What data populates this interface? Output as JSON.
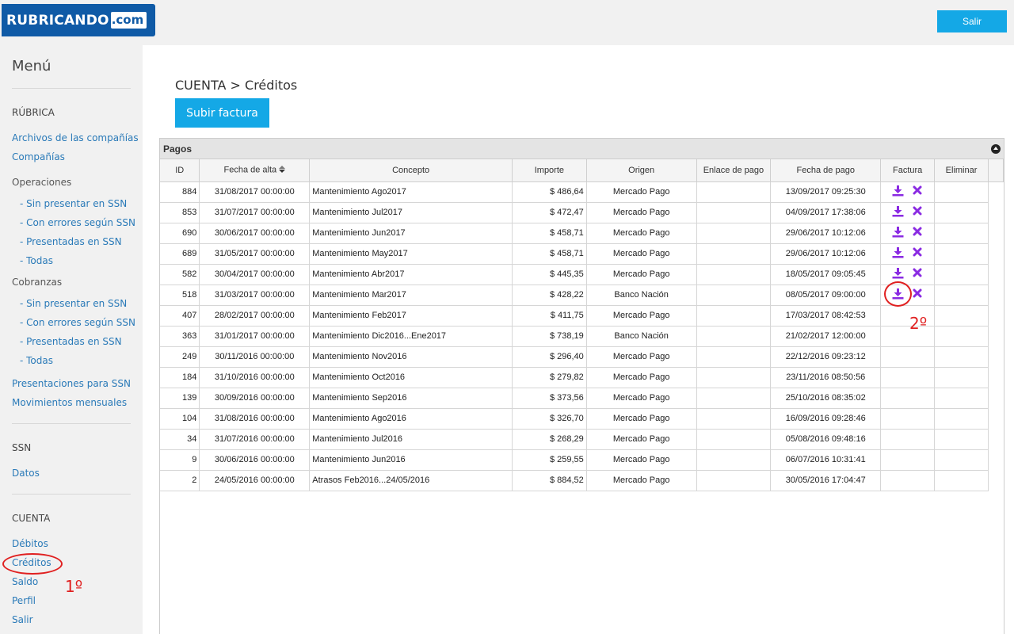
{
  "header": {
    "logo_part1": "RUBRICANDO",
    "logo_part2": ".com",
    "logout_label": "Salir"
  },
  "sidebar": {
    "title": "Menú",
    "rubrica": {
      "heading": "RÚBRICA",
      "archivos": "Archivos de las compañías",
      "companias": "Compañías",
      "operaciones": "Operaciones",
      "op_sin_presentar": "- Sin presentar en SSN",
      "op_con_errores": "- Con errores según SSN",
      "op_presentadas": "- Presentadas en SSN",
      "op_todas": "- Todas",
      "cobranzas": "Cobranzas",
      "co_sin_presentar": "- Sin presentar en SSN",
      "co_con_errores": "- Con errores según SSN",
      "co_presentadas": "- Presentadas en SSN",
      "co_todas": "- Todas",
      "presentaciones": "Presentaciones para SSN",
      "movimientos": "Movimientos mensuales"
    },
    "ssn": {
      "heading": "SSN",
      "datos": "Datos"
    },
    "cuenta": {
      "heading": "CUENTA",
      "debitos": "Débitos",
      "creditos": "Créditos",
      "saldo": "Saldo",
      "perfil": "Perfil",
      "salir": "Salir"
    }
  },
  "main": {
    "breadcrumb": "CUENTA > Créditos",
    "upload_label": "Subir factura",
    "panel_title": "Pagos",
    "columns": [
      "ID",
      "Fecha de alta",
      "Concepto",
      "Importe",
      "Origen",
      "Enlace de pago",
      "Fecha de pago",
      "Factura",
      "Eliminar"
    ],
    "rows": [
      {
        "id": "884",
        "fecha_alta": "31/08/2017 00:00:00",
        "concepto": "Mantenimiento Ago2017",
        "importe": "$ 486,64",
        "origen": "Mercado Pago",
        "enlace": "",
        "fecha_pago": "13/09/2017 09:25:30",
        "factura": true
      },
      {
        "id": "853",
        "fecha_alta": "31/07/2017 00:00:00",
        "concepto": "Mantenimiento Jul2017",
        "importe": "$ 472,47",
        "origen": "Mercado Pago",
        "enlace": "",
        "fecha_pago": "04/09/2017 17:38:06",
        "factura": true
      },
      {
        "id": "690",
        "fecha_alta": "30/06/2017 00:00:00",
        "concepto": "Mantenimiento Jun2017",
        "importe": "$ 458,71",
        "origen": "Mercado Pago",
        "enlace": "",
        "fecha_pago": "29/06/2017 10:12:06",
        "factura": true
      },
      {
        "id": "689",
        "fecha_alta": "31/05/2017 00:00:00",
        "concepto": "Mantenimiento May2017",
        "importe": "$ 458,71",
        "origen": "Mercado Pago",
        "enlace": "",
        "fecha_pago": "29/06/2017 10:12:06",
        "factura": true
      },
      {
        "id": "582",
        "fecha_alta": "30/04/2017 00:00:00",
        "concepto": "Mantenimiento Abr2017",
        "importe": "$ 445,35",
        "origen": "Mercado Pago",
        "enlace": "",
        "fecha_pago": "18/05/2017 09:05:45",
        "factura": true
      },
      {
        "id": "518",
        "fecha_alta": "31/03/2017 00:00:00",
        "concepto": "Mantenimiento Mar2017",
        "importe": "$ 428,22",
        "origen": "Banco Nación",
        "enlace": "",
        "fecha_pago": "08/05/2017 09:00:00",
        "factura": true
      },
      {
        "id": "407",
        "fecha_alta": "28/02/2017 00:00:00",
        "concepto": "Mantenimiento Feb2017",
        "importe": "$ 411,75",
        "origen": "Mercado Pago",
        "enlace": "",
        "fecha_pago": "17/03/2017 08:42:53",
        "factura": false
      },
      {
        "id": "363",
        "fecha_alta": "31/01/2017 00:00:00",
        "concepto": "Mantenimiento Dic2016...Ene2017",
        "importe": "$ 738,19",
        "origen": "Banco Nación",
        "enlace": "",
        "fecha_pago": "21/02/2017 12:00:00",
        "factura": false
      },
      {
        "id": "249",
        "fecha_alta": "30/11/2016 00:00:00",
        "concepto": "Mantenimiento Nov2016",
        "importe": "$ 296,40",
        "origen": "Mercado Pago",
        "enlace": "",
        "fecha_pago": "22/12/2016 09:23:12",
        "factura": false
      },
      {
        "id": "184",
        "fecha_alta": "31/10/2016 00:00:00",
        "concepto": "Mantenimiento Oct2016",
        "importe": "$ 279,82",
        "origen": "Mercado Pago",
        "enlace": "",
        "fecha_pago": "23/11/2016 08:50:56",
        "factura": false
      },
      {
        "id": "139",
        "fecha_alta": "30/09/2016 00:00:00",
        "concepto": "Mantenimiento Sep2016",
        "importe": "$ 373,56",
        "origen": "Mercado Pago",
        "enlace": "",
        "fecha_pago": "25/10/2016 08:35:02",
        "factura": false
      },
      {
        "id": "104",
        "fecha_alta": "31/08/2016 00:00:00",
        "concepto": "Mantenimiento Ago2016",
        "importe": "$ 326,70",
        "origen": "Mercado Pago",
        "enlace": "",
        "fecha_pago": "16/09/2016 09:28:46",
        "factura": false
      },
      {
        "id": "34",
        "fecha_alta": "31/07/2016 00:00:00",
        "concepto": "Mantenimiento Jul2016",
        "importe": "$ 268,29",
        "origen": "Mercado Pago",
        "enlace": "",
        "fecha_pago": "05/08/2016 09:48:16",
        "factura": false
      },
      {
        "id": "9",
        "fecha_alta": "30/06/2016 00:00:00",
        "concepto": "Mantenimiento Jun2016",
        "importe": "$ 259,55",
        "origen": "Mercado Pago",
        "enlace": "",
        "fecha_pago": "06/07/2016 10:31:41",
        "factura": false
      },
      {
        "id": "2",
        "fecha_alta": "24/05/2016 00:00:00",
        "concepto": "Atrasos Feb2016...24/05/2016",
        "importe": "$ 884,52",
        "origen": "Mercado Pago",
        "enlace": "",
        "fecha_pago": "30/05/2016 17:04:47",
        "factura": false
      }
    ]
  },
  "annotations": {
    "step1": "1º",
    "step2": "2º"
  },
  "colors": {
    "accent": "#14a8e6",
    "brand": "#0f5aa6",
    "action_icon": "#8a2be2",
    "annotation": "#e02020"
  },
  "icons": {
    "download": "download-icon",
    "delete": "delete-icon",
    "sort": "sort-icon",
    "collapse": "collapse-icon"
  }
}
